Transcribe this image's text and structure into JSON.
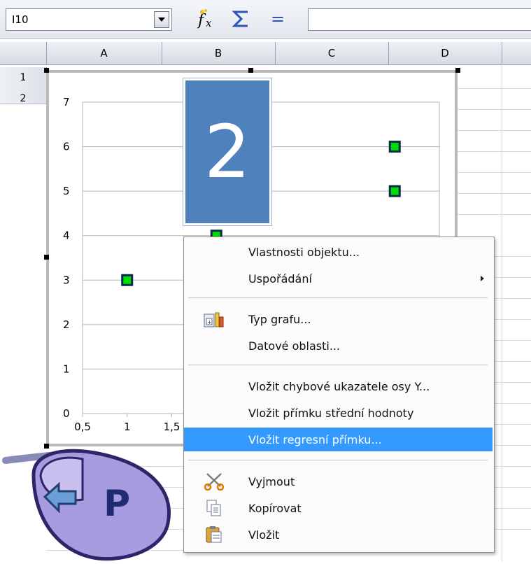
{
  "toolbar": {
    "cell_ref": "I10",
    "fx_icon": "function-wizard-icon",
    "sum_icon": "sum-icon",
    "equals_label": "=",
    "formula_value": ""
  },
  "columns": [
    "A",
    "B",
    "C",
    "D"
  ],
  "rows": [
    "1",
    "2"
  ],
  "slide_badge": "2",
  "chart_data": {
    "type": "scatter",
    "x_ticks": [
      "0,5",
      "1",
      "1,5"
    ],
    "y_ticks": [
      "0",
      "1",
      "2",
      "3",
      "4",
      "5",
      "6",
      "7"
    ],
    "xlim": [
      0.5,
      4.5
    ],
    "ylim": [
      0,
      7
    ],
    "points": [
      {
        "x": 1,
        "y": 3
      },
      {
        "x": 2,
        "y": 4
      },
      {
        "x": 4,
        "y": 5
      },
      {
        "x": 4,
        "y": 6
      }
    ],
    "marker_color": "#00dd00",
    "grid": true
  },
  "context_menu": {
    "items": [
      {
        "label": "Vlastnosti objektu...",
        "mnemonic": "V"
      },
      {
        "label": "Uspořádání",
        "submenu": true
      },
      {
        "label": "Typ grafu...",
        "icon": "chart-type-icon"
      },
      {
        "label": "Datové oblasti..."
      },
      {
        "label": "Vložit chybové ukazatele osy Y..."
      },
      {
        "label": "Vložit přímku střední hodnoty"
      },
      {
        "label": "Vložit regresní přímku...",
        "highlighted": true
      },
      {
        "label": "Vyjmout",
        "icon": "scissors-icon"
      },
      {
        "label": "Kopírovat",
        "icon": "copy-icon"
      },
      {
        "label": "Vložit",
        "icon": "paste-icon"
      }
    ]
  },
  "mouse_overlay": {
    "letter": "P",
    "icon": "mouse-right-click-icon"
  }
}
